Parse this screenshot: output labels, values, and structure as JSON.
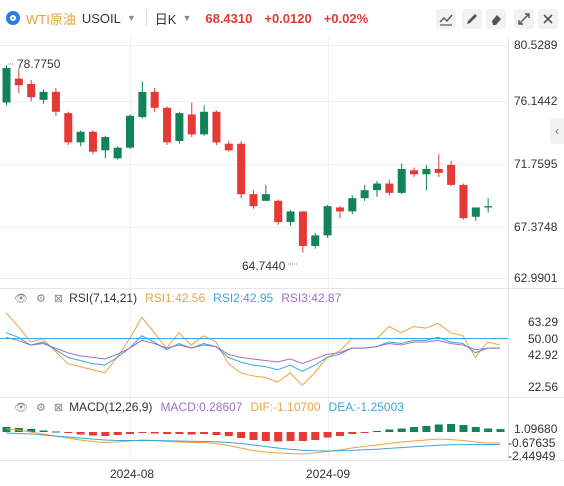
{
  "header": {
    "name": "WTI原油",
    "symbol": "USOIL",
    "period": "日K",
    "price": "68.4310",
    "change": "+0.0120",
    "change_pct": "+0.02%"
  },
  "main": {
    "price_axis": [
      "80.5289",
      "76.1442",
      "71.7595",
      "67.3748",
      "62.9901"
    ],
    "annotation_high": "78.7750",
    "annotation_low": "64.7440"
  },
  "rsi": {
    "label": "RSI(7,14,21)",
    "rsi1": "RSI1:42.56",
    "rsi2": "RSI2:42.95",
    "rsi3": "RSI3:42.87",
    "axis": [
      "63.29",
      "50.00",
      "42.92",
      "22.56"
    ]
  },
  "macd": {
    "label": "MACD(12,26,9)",
    "macd": "MACD:0.28607",
    "dif": "DIF:-1.10700",
    "dea": "DEA:-1.25003",
    "axis": [
      "1.09680",
      "-0.67635",
      "-2.44949"
    ]
  },
  "time_axis": [
    "2024-08",
    "2024-09"
  ],
  "colors": {
    "up": "#e53935",
    "down": "#12825a",
    "rsi1": "#f0a040",
    "rsi2": "#3aa8d8",
    "rsi3": "#a070c8",
    "accent": "#2a7de1"
  },
  "chart_data": [
    {
      "type": "candlestick",
      "ylim": [
        62.9901,
        80.5289
      ],
      "candles": [
        {
          "o": 76.2,
          "h": 79.0,
          "l": 76.0,
          "c": 78.8
        },
        {
          "o": 78.0,
          "h": 78.8,
          "l": 76.9,
          "c": 77.5
        },
        {
          "o": 77.6,
          "h": 77.9,
          "l": 76.3,
          "c": 76.6
        },
        {
          "o": 76.4,
          "h": 77.2,
          "l": 76.1,
          "c": 77.0
        },
        {
          "o": 77.0,
          "h": 77.3,
          "l": 75.2,
          "c": 75.5
        },
        {
          "o": 75.4,
          "h": 75.5,
          "l": 73.0,
          "c": 73.2
        },
        {
          "o": 73.2,
          "h": 74.1,
          "l": 72.9,
          "c": 74.0
        },
        {
          "o": 74.0,
          "h": 74.1,
          "l": 72.3,
          "c": 72.5
        },
        {
          "o": 72.6,
          "h": 73.7,
          "l": 72.0,
          "c": 73.6
        },
        {
          "o": 72.0,
          "h": 72.9,
          "l": 71.9,
          "c": 72.8
        },
        {
          "o": 72.8,
          "h": 75.3,
          "l": 72.7,
          "c": 75.2
        },
        {
          "o": 75.1,
          "h": 77.8,
          "l": 75.0,
          "c": 77.0
        },
        {
          "o": 77.0,
          "h": 77.3,
          "l": 75.5,
          "c": 75.8
        },
        {
          "o": 75.8,
          "h": 75.9,
          "l": 73.0,
          "c": 73.2
        },
        {
          "o": 73.3,
          "h": 75.5,
          "l": 73.1,
          "c": 75.4
        },
        {
          "o": 75.3,
          "h": 76.2,
          "l": 73.6,
          "c": 73.8
        },
        {
          "o": 73.8,
          "h": 76.0,
          "l": 73.7,
          "c": 75.5
        },
        {
          "o": 75.5,
          "h": 75.6,
          "l": 73.0,
          "c": 73.2
        },
        {
          "o": 73.1,
          "h": 73.3,
          "l": 72.5,
          "c": 72.6
        },
        {
          "o": 73.1,
          "h": 73.3,
          "l": 69.0,
          "c": 69.3
        },
        {
          "o": 69.3,
          "h": 69.6,
          "l": 68.2,
          "c": 68.4
        },
        {
          "o": 68.8,
          "h": 70.0,
          "l": 68.8,
          "c": 69.3
        },
        {
          "o": 68.8,
          "h": 68.9,
          "l": 67.0,
          "c": 67.2
        },
        {
          "o": 67.2,
          "h": 68.1,
          "l": 66.9,
          "c": 68.0
        },
        {
          "o": 68.0,
          "h": 68.0,
          "l": 64.9,
          "c": 65.4
        },
        {
          "o": 65.4,
          "h": 66.4,
          "l": 65.2,
          "c": 66.2
        },
        {
          "o": 66.2,
          "h": 68.5,
          "l": 66.0,
          "c": 68.4
        },
        {
          "o": 68.3,
          "h": 68.4,
          "l": 67.5,
          "c": 68.0
        },
        {
          "o": 68.0,
          "h": 69.2,
          "l": 67.8,
          "c": 69.0
        },
        {
          "o": 69.0,
          "h": 70.0,
          "l": 68.8,
          "c": 69.6
        },
        {
          "o": 69.6,
          "h": 70.3,
          "l": 69.1,
          "c": 70.1
        },
        {
          "o": 70.1,
          "h": 70.4,
          "l": 69.2,
          "c": 69.4
        },
        {
          "o": 69.4,
          "h": 71.6,
          "l": 69.3,
          "c": 71.2
        },
        {
          "o": 71.1,
          "h": 71.3,
          "l": 70.6,
          "c": 70.8
        },
        {
          "o": 70.8,
          "h": 71.5,
          "l": 69.6,
          "c": 71.2
        },
        {
          "o": 71.2,
          "h": 72.3,
          "l": 70.6,
          "c": 70.9
        },
        {
          "o": 71.5,
          "h": 71.8,
          "l": 69.9,
          "c": 70.0
        },
        {
          "o": 70.0,
          "h": 70.1,
          "l": 67.4,
          "c": 67.5
        },
        {
          "o": 67.6,
          "h": 68.3,
          "l": 67.3,
          "c": 68.3
        },
        {
          "o": 68.3,
          "h": 69.0,
          "l": 67.9,
          "c": 68.4
        }
      ]
    },
    {
      "type": "line",
      "title": "RSI(7,14,21)",
      "ylim": [
        15,
        72
      ],
      "series": [
        {
          "name": "RSI1",
          "values": [
            69,
            60,
            50,
            52,
            44,
            36,
            34,
            32,
            30,
            40,
            52,
            66,
            56,
            46,
            56,
            48,
            54,
            50,
            36,
            30,
            28,
            27,
            24,
            30,
            22,
            30,
            40,
            44,
            52,
            52,
            52,
            60,
            56,
            60,
            59,
            62,
            56,
            54,
            40,
            50,
            48
          ]
        },
        {
          "name": "RSI2",
          "values": [
            56,
            53,
            48,
            50,
            45,
            40,
            38,
            36,
            35,
            40,
            46,
            54,
            50,
            45,
            49,
            46,
            49,
            47,
            40,
            37,
            35,
            34,
            32,
            35,
            31,
            35,
            40,
            42,
            46,
            46,
            47,
            50,
            49,
            51,
            51,
            53,
            50,
            49,
            43,
            46,
            46
          ]
        },
        {
          "name": "RSI3",
          "values": [
            53,
            51,
            48,
            49,
            46,
            43,
            41,
            40,
            39,
            42,
            46,
            51,
            49,
            46,
            48,
            46,
            48,
            47,
            42,
            40,
            39,
            38,
            37,
            39,
            36,
            39,
            42,
            43,
            46,
            46,
            47,
            49,
            48,
            50,
            50,
            51,
            49,
            48,
            45,
            46,
            46
          ]
        }
      ]
    },
    {
      "type": "bar+line",
      "title": "MACD(12,26,9)",
      "ylim": [
        -3.0,
        1.4
      ],
      "series": [
        {
          "name": "MACD",
          "values": [
            0.5,
            0.4,
            0.3,
            0.15,
            0.05,
            -0.1,
            -0.25,
            -0.35,
            -0.4,
            -0.3,
            -0.2,
            -0.1,
            -0.15,
            -0.2,
            -0.2,
            -0.25,
            -0.2,
            -0.3,
            -0.4,
            -0.6,
            -0.8,
            -0.9,
            -0.95,
            -0.9,
            -0.9,
            -0.8,
            -0.55,
            -0.4,
            -0.2,
            -0.05,
            0.1,
            0.25,
            0.35,
            0.5,
            0.6,
            0.75,
            0.8,
            0.7,
            0.5,
            0.35,
            0.29
          ]
        },
        {
          "name": "DIF",
          "values": [
            0.3,
            0.2,
            0.0,
            -0.2,
            -0.4,
            -0.6,
            -0.8,
            -0.95,
            -1.05,
            -1.0,
            -0.9,
            -0.8,
            -0.85,
            -0.95,
            -1.0,
            -1.05,
            -1.05,
            -1.15,
            -1.35,
            -1.6,
            -1.85,
            -2.0,
            -2.1,
            -2.15,
            -2.2,
            -2.1,
            -1.95,
            -1.8,
            -1.6,
            -1.45,
            -1.3,
            -1.15,
            -1.0,
            -0.9,
            -0.8,
            -0.7,
            -0.75,
            -0.85,
            -1.0,
            -1.1,
            -1.1
          ]
        },
        {
          "name": "DEA",
          "values": [
            -0.1,
            -0.15,
            -0.2,
            -0.3,
            -0.4,
            -0.5,
            -0.6,
            -0.7,
            -0.8,
            -0.85,
            -0.85,
            -0.85,
            -0.85,
            -0.87,
            -0.9,
            -0.93,
            -0.95,
            -0.98,
            -1.05,
            -1.15,
            -1.3,
            -1.45,
            -1.6,
            -1.72,
            -1.82,
            -1.88,
            -1.9,
            -1.88,
            -1.84,
            -1.78,
            -1.72,
            -1.64,
            -1.56,
            -1.48,
            -1.4,
            -1.32,
            -1.28,
            -1.26,
            -1.25,
            -1.25,
            -1.25
          ]
        }
      ]
    }
  ]
}
